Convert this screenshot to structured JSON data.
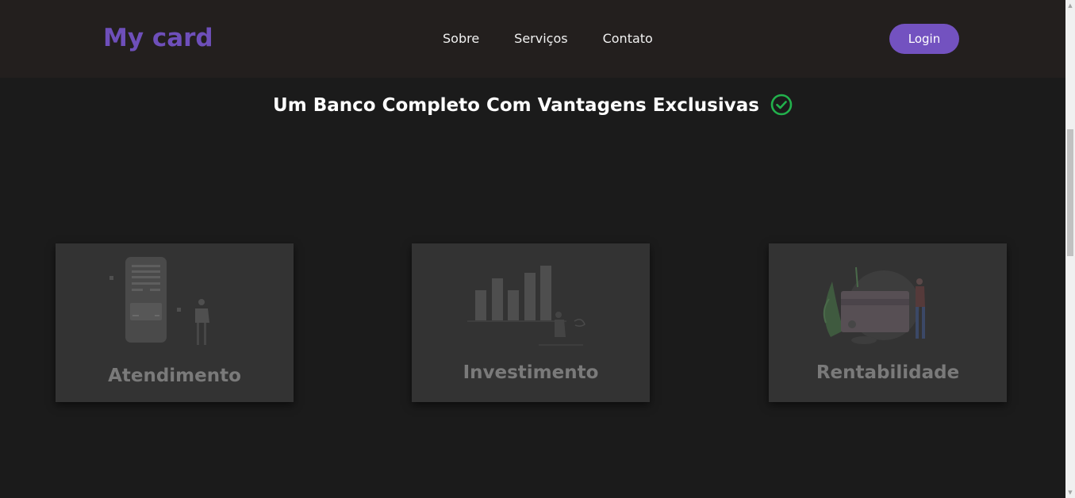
{
  "navbar": {
    "brand": "My card",
    "links": [
      "Sobre",
      "Serviços",
      "Contato"
    ],
    "login_label": "Login"
  },
  "hero": {
    "headline": "Um Banco Completo Com Vantagens Exclusivas",
    "headline_icon": "check-circle-icon"
  },
  "cards": [
    {
      "title": "Atendimento",
      "illustration": "mobile-app-person-illustration"
    },
    {
      "title": "Investimento",
      "illustration": "bar-chart-person-illustration"
    },
    {
      "title": "Rentabilidade",
      "illustration": "credit-card-plants-illustration"
    }
  ],
  "colors": {
    "background": "#1b1b1b",
    "navbar": "#231f1e",
    "brand": "#6e4fba",
    "login_button": "#7352c0",
    "card": "#333333",
    "card_text": "#7a7a7a",
    "check_icon": "#22b14c"
  }
}
